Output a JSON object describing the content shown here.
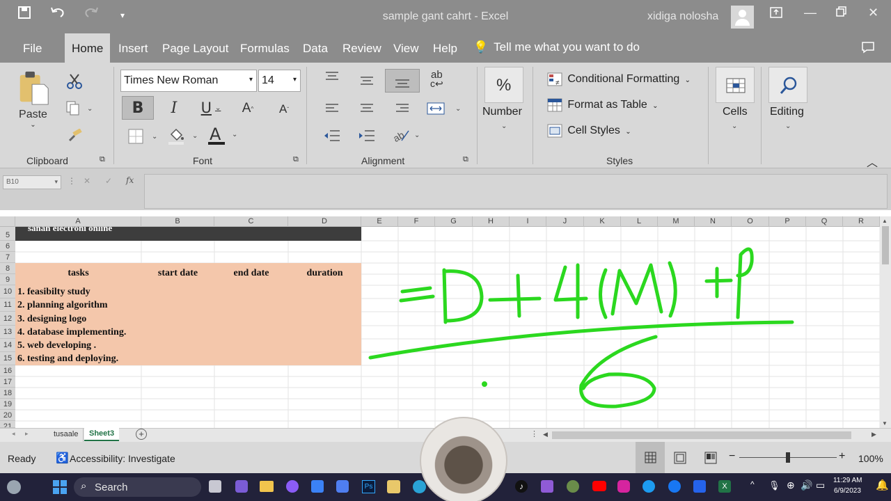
{
  "window": {
    "title": "sample gant cahrt  -  Excel",
    "user": "xidiga nolosha"
  },
  "menu": {
    "tabs": [
      "File",
      "Home",
      "Insert",
      "Page Layout",
      "Formulas",
      "Data",
      "Review",
      "View",
      "Help"
    ],
    "active": "Home",
    "tellme": "Tell me what you want to do"
  },
  "ribbon": {
    "clipboard": {
      "paste": "Paste",
      "label": "Clipboard"
    },
    "font": {
      "name": "Times New Roman",
      "size": "14",
      "label": "Font"
    },
    "alignment": {
      "label": "Alignment"
    },
    "number": {
      "label": "Number"
    },
    "styles": {
      "conditional": "Conditional Formatting",
      "table": "Format as Table",
      "cell_styles": "Cell Styles",
      "label": "Styles"
    },
    "cells": {
      "label": "Cells"
    },
    "editing": {
      "label": "Editing"
    }
  },
  "formula_bar": {
    "name_box": "B10",
    "fx": "fx",
    "value": ""
  },
  "columns": [
    "A",
    "B",
    "C",
    "D",
    "E",
    "F",
    "G",
    "H",
    "I",
    "J",
    "K",
    "L",
    "M",
    "N",
    "O",
    "P",
    "Q",
    "R"
  ],
  "rows": [
    "5",
    "6",
    "7",
    "8",
    "9",
    "10",
    "11",
    "12",
    "13",
    "14",
    "15",
    "16",
    "17",
    "18",
    "19",
    "20",
    "21"
  ],
  "sheet": {
    "row5_text": "sanah electroni online",
    "headers": {
      "tasks": "tasks",
      "start": "start date",
      "end": "end date",
      "duration": "duration"
    },
    "tasks": [
      "1. feasibilty study",
      "2. planning algorithm",
      "3. designing logo",
      "4. database implementing.",
      "5. web developing .",
      "6. testing and deploying."
    ]
  },
  "annotation": {
    "formula_top": "=D+4(M)+P",
    "formula_bottom": "6",
    "color": "#2bd81f"
  },
  "sheet_tabs": [
    "tusaale",
    "Sheet3"
  ],
  "active_sheet": "Sheet3",
  "status": {
    "ready": "Ready",
    "accessibility": "Accessibility: Investigate",
    "zoom": "100%"
  },
  "taskbar": {
    "search": "Search",
    "time": "11:29 AM",
    "date": "6/9/2023"
  },
  "colors": {
    "accent": "#217346",
    "fill": "#f4c7ab",
    "ribbon": "#d8d8d8",
    "titlebar": "#8c8c8c"
  }
}
